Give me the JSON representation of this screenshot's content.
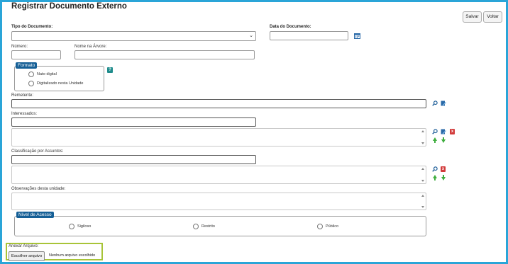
{
  "page": {
    "title": "Registrar Documento Externo"
  },
  "toolbar": {
    "save_label": "Salvar",
    "back_label": "Voltar"
  },
  "fields": {
    "tipo_documento": {
      "label": "Tipo do Documento:",
      "value": ""
    },
    "data_documento": {
      "label": "Data do Documento:",
      "value": ""
    },
    "numero": {
      "label": "Número:",
      "value": ""
    },
    "nome_arvore": {
      "label": "Nome na Árvore:",
      "value": ""
    },
    "remetente": {
      "label": "Remetente:",
      "value": ""
    },
    "interessados": {
      "label": "Interessados:",
      "value": ""
    },
    "classificacao": {
      "label": "Classificação por Assuntos:",
      "value": ""
    },
    "observacoes": {
      "label": "Observações desta unidade:",
      "value": ""
    },
    "anexar": {
      "label": "Anexar Arquivo:",
      "button": "Escolher arquivo",
      "status": "Nenhum arquivo escolhido"
    }
  },
  "formato": {
    "legend": "Formato",
    "options": [
      "Nato-digital",
      "Digitalizado nesta Unidade"
    ],
    "help": "?"
  },
  "nivel_acesso": {
    "legend": "Nível de Acesso",
    "options": [
      "Sigiloso",
      "Restrito",
      "Público"
    ]
  },
  "icons": {
    "calendar": "calendar-icon",
    "search": "search-icon",
    "edit": "edit-icon",
    "remove": "remove-icon",
    "move_up": "arrow-up-icon",
    "move_down": "arrow-down-icon",
    "remove_glyph": "x"
  },
  "colors": {
    "frame": "#2aa5d8",
    "legend_bg": "#155f96",
    "attach_highlight": "#a8c438",
    "arrow": "#3fae3f",
    "remove": "#d23b3b"
  }
}
